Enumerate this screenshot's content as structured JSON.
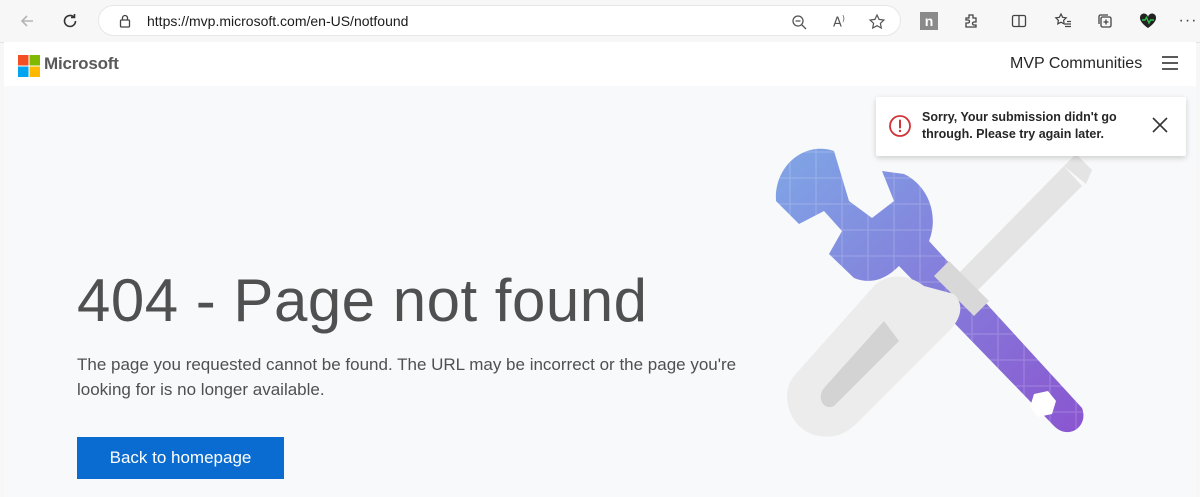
{
  "browser": {
    "url": "https://mvp.microsoft.com/en-US/notfound",
    "icons": [
      "back-icon",
      "refresh-icon",
      "lock-icon",
      "zoom-out-icon",
      "read-aloud-icon",
      "favorite-star-icon",
      "n-extension-icon",
      "extensions-icon",
      "split-screen-icon",
      "favorites-icon",
      "collections-icon",
      "health-extension-icon",
      "more-icon"
    ]
  },
  "header": {
    "brand": "Microsoft",
    "communities_link": "MVP Communities"
  },
  "main": {
    "title": "404 - Page not found",
    "description": "The page you requested cannot be found. The URL may be incorrect or the page you're looking for is no longer available.",
    "button_label": "Back to homepage"
  },
  "toast": {
    "message": "Sorry, Your submission didn't go through. Please try again later."
  },
  "colors": {
    "accent": "#0a6cd0",
    "error": "#d13438",
    "wrench": "#7b6fd6",
    "screwdriver": "#e9e9e9"
  }
}
